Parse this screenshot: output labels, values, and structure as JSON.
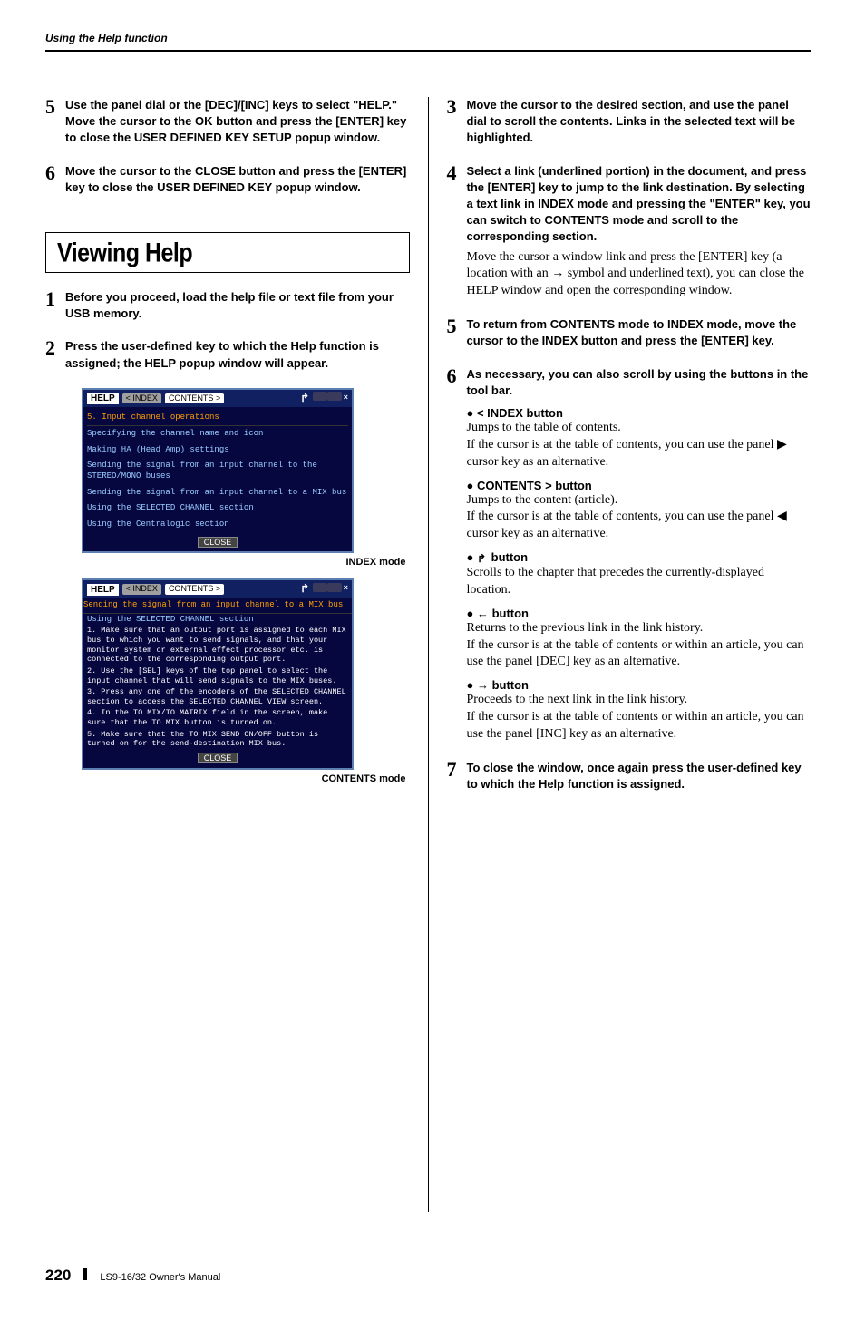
{
  "header": {
    "running": "Using the Help function"
  },
  "left": {
    "step5": "Use the panel dial or the [DEC]/[INC] keys to select \"HELP.\" Move the cursor to the OK button and press the [ENTER] key to close the USER DEFINED KEY SETUP popup window.",
    "step6": "Move the cursor to the CLOSE button and press the [ENTER] key to close the USER DEFINED KEY popup window.",
    "heading": "Viewing Help",
    "v1": "Before you proceed, load the help file or text file from your USB memory.",
    "v2": "Press the user-defined key to which the Help function is assigned; the HELP popup window will appear.",
    "fig1": {
      "title": "HELP",
      "btn_index": "< INDEX",
      "btn_contents": "CONTENTS >",
      "hdr": "5. Input channel operations",
      "l1": "Specifying the channel name and icon",
      "l2": "Making HA (Head Amp) settings",
      "l3": "Sending the signal from an input channel to the STEREO/MONO buses",
      "l4": "Sending the signal from an input channel to a MIX bus",
      "l5": "Using the SELECTED CHANNEL section",
      "l6": "Using the Centralogic section",
      "close": "CLOSE",
      "caption": "INDEX mode"
    },
    "fig2": {
      "title": "HELP",
      "btn_index": "< INDEX",
      "btn_contents": "CONTENTS >",
      "hdr": "Sending the signal from an input channel to a MIX bus",
      "sec": "Using the SELECTED CHANNEL section",
      "body1": "1. Make sure that an output port is assigned to each MIX bus to which you want to send signals, and that your monitor system or external effect processor etc. is connected to the corresponding output port.",
      "body2": "2. Use the [SEL] keys of the top panel to select the input channel that will send signals to the MIX buses.",
      "body3": "3. Press any one of the encoders of the SELECTED CHANNEL section to access the SELECTED CHANNEL VIEW screen.",
      "body4": "4. In the TO MIX/TO MATRIX field in the screen, make sure that the TO MIX button is turned on.",
      "body5": "5. Make sure that the TO MIX SEND ON/OFF button is turned on for the send-destination MIX bus.",
      "close": "CLOSE",
      "caption": "CONTENTS mode"
    }
  },
  "right": {
    "step3": "Move the cursor to the desired section, and use the panel dial to scroll the contents. Links in the selected text will be highlighted.",
    "step4": "Select a link (underlined portion) in the document, and press the [ENTER] key to jump to the link destination. By selecting a text link in INDEX mode and pressing the \"ENTER\" key, you can switch to CONTENTS mode and scroll to the corresponding section.",
    "step4body": "Move the cursor a window link and press the [ENTER] key (a location with an → symbol and underlined text), you can close the HELP window and open the corresponding window.",
    "step5": "To return from CONTENTS mode to INDEX mode, move the cursor to the INDEX button and press the [ENTER] key.",
    "step6": "As necessary, you can also scroll by using the buttons in the tool bar.",
    "btn_index_t": "● < INDEX button",
    "btn_index_b1": "Jumps to the table of contents.",
    "btn_index_b2": "If the cursor is at the table of contents, you can use the panel ▶ cursor key as an alternative.",
    "btn_contents_t": "● CONTENTS > button",
    "btn_contents_b1": "Jumps to the content (article).",
    "btn_contents_b2": "If the cursor is at the table of contents, you can use the panel ◀ cursor key as an alternative.",
    "btn_up_t": "●  button",
    "btn_up_b": "Scrolls to the chapter that precedes the currently-displayed location.",
    "btn_left_t": "● ← button",
    "btn_left_b1": "Returns to the previous link in the link history.",
    "btn_left_b2": "If the cursor is at the table of contents or within an article, you can use the panel [DEC] key as an alternative.",
    "btn_right_t": "● → button",
    "btn_right_b1": "Proceeds to the next link in the link history.",
    "btn_right_b2": "If the cursor is at the table of contents or within an article, you can use the panel [INC] key as an alternative.",
    "step7": "To close the window, once again press the user-defined key to which the Help function is assigned."
  },
  "footer": {
    "page": "220",
    "text": "LS9-16/32  Owner's Manual"
  }
}
